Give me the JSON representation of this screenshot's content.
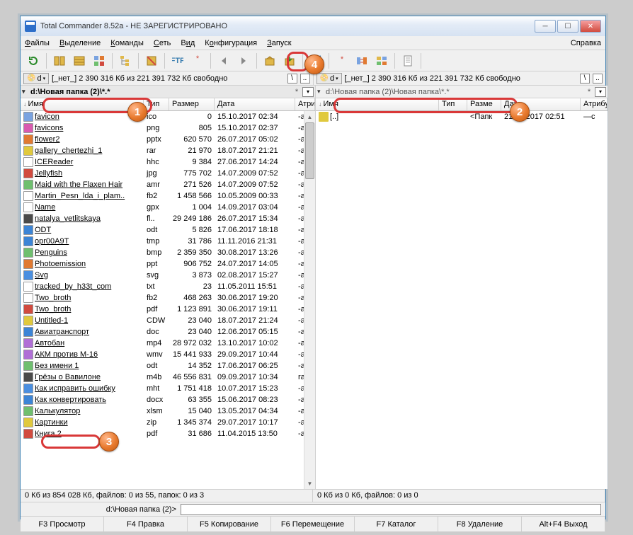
{
  "window": {
    "title": "Total Commander 8.52a - НЕ ЗАРЕГИСТРИРОВАНО",
    "minimize": "─",
    "maximize": "☐",
    "close": "✕"
  },
  "menu": {
    "items": [
      "Файлы",
      "Выделение",
      "Команды",
      "Сеть",
      "Вид",
      "Конфигурация",
      "Запуск"
    ],
    "help": "Справка"
  },
  "drive": {
    "left_btn": "d",
    "right_btn": "d",
    "left_info": "[_нет_]  2 390 316 Кб из 221 391 732 Кб свободно",
    "right_info": "[_нет_]  2 390 316 Кб из 221 391 732 Кб свободно",
    "root": "\\",
    "up": ".."
  },
  "path": {
    "left": "d:\\Новая папка (2)\\*.*",
    "right": "d:\\Новая папка (2)\\Новая папка\\*.*"
  },
  "columns": {
    "name": "Имя",
    "ext": "Тип",
    "size": "Размер",
    "date": "Дата",
    "attr": "Атрибу"
  },
  "columns_r": {
    "name": "Имя",
    "ext": "Тип",
    "size": "Разме",
    "date": "Дата",
    "attr": "Атрибу"
  },
  "right_entry": {
    "name": "[..]",
    "ext": "",
    "size": "<Папк",
    "date": "21.10.2017 02:51",
    "attr": "—c"
  },
  "files": [
    {
      "ico": "#7aa3e0",
      "name": "favicon",
      "ext": "ico",
      "size": "0",
      "date": "15.10.2017 02:34",
      "attr": "-a-«"
    },
    {
      "ico": "#d95bb0",
      "name": "favicons",
      "ext": "png",
      "size": "805",
      "date": "15.10.2017 02:37",
      "attr": "-a-«"
    },
    {
      "ico": "#e07a32",
      "name": "flower2",
      "ext": "pptx",
      "size": "620 570",
      "date": "26.07.2017 05:02",
      "attr": "-a-«"
    },
    {
      "ico": "#e0c93e",
      "name": "gallery_chertezhi_1",
      "ext": "rar",
      "size": "21 970",
      "date": "18.07.2017 21:21",
      "attr": "-a-«"
    },
    {
      "ico": "#ffffff",
      "name": "ICEReader",
      "ext": "hhc",
      "size": "9 384",
      "date": "27.06.2017 14:24",
      "attr": "-a-«"
    },
    {
      "ico": "#d14b3f",
      "name": "Jellyfish",
      "ext": "jpg",
      "size": "775 702",
      "date": "14.07.2009 07:52",
      "attr": "-a-«"
    },
    {
      "ico": "#6fbf6f",
      "name": "Maid with the Flaxen Hair",
      "ext": "amr",
      "size": "271 526",
      "date": "14.07.2009 07:52",
      "attr": "-a-«"
    },
    {
      "ico": "#ffffff",
      "name": "Martin_Pesn_lda_i_plam..",
      "ext": "fb2",
      "size": "1 458 566",
      "date": "10.05.2009 00:33",
      "attr": "-a-«"
    },
    {
      "ico": "#ffffff",
      "name": "Name",
      "ext": "gpx",
      "size": "1 004",
      "date": "14.09.2017 03:04",
      "attr": "-a-«"
    },
    {
      "ico": "#4a4a4a",
      "name": "natalya_vetlitskaya",
      "ext": "fl..",
      "size": "29 249 186",
      "date": "26.07.2017 15:34",
      "attr": "-a-«"
    },
    {
      "ico": "#3c85d6",
      "name": "ODT",
      "ext": "odt",
      "size": "5 826",
      "date": "17.06.2017 18:18",
      "attr": "-a-«"
    },
    {
      "ico": "#3c85d6",
      "name": "opr00A9T",
      "ext": "tmp",
      "size": "31 786",
      "date": "11.11.2016 21:31",
      "attr": "-a-«"
    },
    {
      "ico": "#6fbf6f",
      "name": "Penguins",
      "ext": "bmp",
      "size": "2 359 350",
      "date": "30.08.2017 13:26",
      "attr": "-a-«"
    },
    {
      "ico": "#e07a32",
      "name": "Photoemission",
      "ext": "ppt",
      "size": "906 752",
      "date": "24.07.2017 14:05",
      "attr": "-a-«"
    },
    {
      "ico": "#4a8fe0",
      "name": "Svg",
      "ext": "svg",
      "size": "3 873",
      "date": "02.08.2017 15:27",
      "attr": "-a-«"
    },
    {
      "ico": "#ffffff",
      "name": "tracked_by_h33t_com",
      "ext": "txt",
      "size": "23",
      "date": "11.05.2011 15:51",
      "attr": "-a-«"
    },
    {
      "ico": "#ffffff",
      "name": "Two_broth",
      "ext": "fb2",
      "size": "468 263",
      "date": "30.06.2017 19:20",
      "attr": "-a-«"
    },
    {
      "ico": "#d14b3f",
      "name": "Two_broth",
      "ext": "pdf",
      "size": "1 123 891",
      "date": "30.06.2017 19:11",
      "attr": "-a-«"
    },
    {
      "ico": "#e0c93e",
      "name": "Untitled-1",
      "ext": "CDW",
      "size": "23 040",
      "date": "18.07.2017 21:24",
      "attr": "-a-«"
    },
    {
      "ico": "#3c85d6",
      "name": "Авиатранспорт",
      "ext": "doc",
      "size": "23 040",
      "date": "12.06.2017 05:15",
      "attr": "-a-«"
    },
    {
      "ico": "#b06fd6",
      "name": "Автобан",
      "ext": "mp4",
      "size": "28 972 032",
      "date": "13.10.2017 10:02",
      "attr": "-a-«"
    },
    {
      "ico": "#b06fd6",
      "name": "АКМ против М-16",
      "ext": "wmv",
      "size": "15 441 933",
      "date": "29.09.2017 10:44",
      "attr": "-a-«"
    },
    {
      "ico": "#6fbf6f",
      "name": "Без имени 1",
      "ext": "odt",
      "size": "14 352",
      "date": "17.06.2017 06:25",
      "attr": "-a-«"
    },
    {
      "ico": "#4a4a4a",
      "name": "Грёзы о Вавилоне",
      "ext": "m4b",
      "size": "46 556 831",
      "date": "09.09.2017 10:34",
      "attr": "ra-«"
    },
    {
      "ico": "#4a8fe0",
      "name": "Как исправить ошибку",
      "ext": "mht",
      "size": "1 751 418",
      "date": "10.07.2017 15:23",
      "attr": "-a-«"
    },
    {
      "ico": "#3c85d6",
      "name": "Как конвертировать",
      "ext": "docx",
      "size": "63 355",
      "date": "15.06.2017 08:23",
      "attr": "-a-«"
    },
    {
      "ico": "#6fbf6f",
      "name": "Калькулятор",
      "ext": "xlsm",
      "size": "15 040",
      "date": "13.05.2017 04:34",
      "attr": "-a-«"
    },
    {
      "ico": "#e0c93e",
      "name": "Картинки",
      "ext": "zip",
      "size": "1 345 374",
      "date": "29.07.2017 10:17",
      "attr": "-a-«",
      "hl": true
    },
    {
      "ico": "#d14b3f",
      "name": "Книга 2",
      "ext": "pdf",
      "size": "31 686",
      "date": "11.04.2015 13:50",
      "attr": "-a-«"
    }
  ],
  "status": {
    "left": "0 Кб из 854 028 Кб, файлов: 0 из 55, папок: 0 из 3",
    "right": "0 Кб из 0 Кб, файлов: 0 из 0"
  },
  "cmdline": {
    "path": "d:\\Новая папка (2)>"
  },
  "fkeys": [
    "F3 Просмотр",
    "F4 Правка",
    "F5 Копирование",
    "F6 Перемещение",
    "F7 Каталог",
    "F8 Удаление",
    "Alt+F4 Выход"
  ]
}
